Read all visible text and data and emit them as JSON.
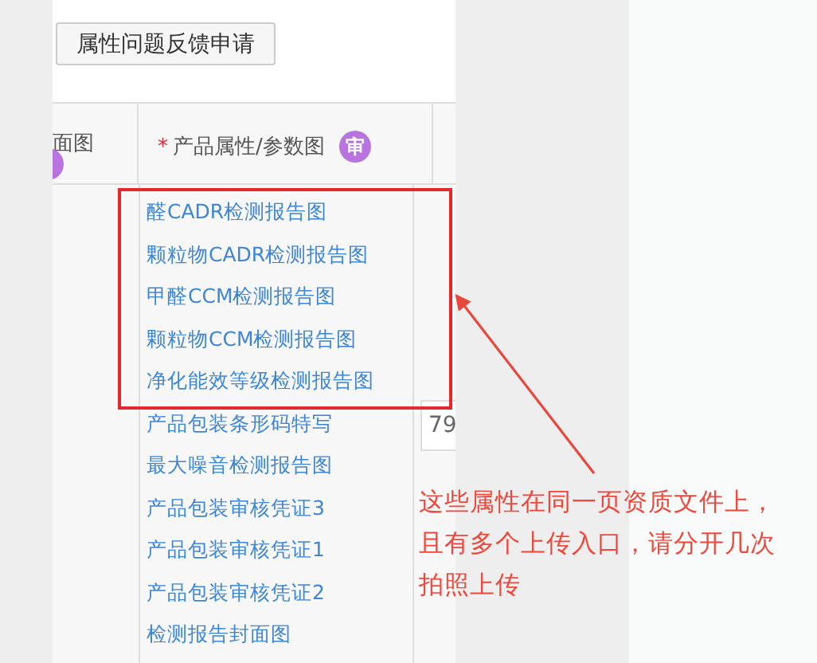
{
  "toolbar": {
    "button": "属性问题反馈申请"
  },
  "table": {
    "columns": [
      {
        "label": "面图",
        "badge_visible": true
      },
      {
        "label": "产品属性/参数图",
        "required": true,
        "required_mark": "*",
        "badge": "审"
      }
    ],
    "attributes": [
      {
        "label": "醛CADR检测报告图",
        "highlighted": true
      },
      {
        "label": "颗粒物CADR检测报告图",
        "highlighted": true
      },
      {
        "label": "甲醛CCM检测报告图",
        "highlighted": true
      },
      {
        "label": "颗粒物CCM检测报告图",
        "highlighted": true
      },
      {
        "label": "净化能效等级检测报告图",
        "highlighted": true
      },
      {
        "label": "产品包装条形码特写",
        "highlighted": false
      },
      {
        "label": "最大噪音检测报告图",
        "highlighted": false
      },
      {
        "label": "产品包装审核凭证3",
        "highlighted": false
      },
      {
        "label": "产品包装审核凭证1",
        "highlighted": false
      },
      {
        "label": "产品包装审核凭证2",
        "highlighted": false
      },
      {
        "label": "检测报告封面图",
        "highlighted": false
      }
    ],
    "input_value": "79"
  },
  "annotation": {
    "text": "这些属性在同一页资质文件上，且有多个上传入口，请分开几次拍照上传"
  }
}
